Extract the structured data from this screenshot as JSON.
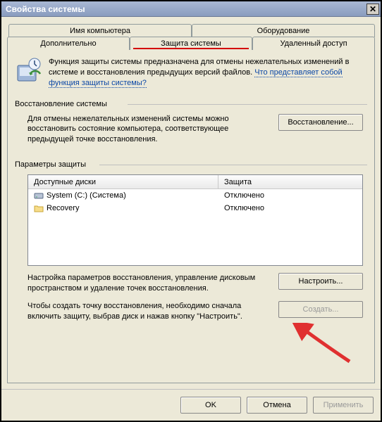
{
  "window": {
    "title": "Свойства системы"
  },
  "tabs_top": [
    {
      "label": "Имя компьютера"
    },
    {
      "label": "Оборудование"
    }
  ],
  "tabs_bottom": [
    {
      "label": "Дополнительно"
    },
    {
      "label": "Защита системы"
    },
    {
      "label": "Удаленный доступ"
    }
  ],
  "intro": {
    "text": "Функция защиты системы предназначена для отмены нежелательных изменений в системе и восстановления предыдущих версий файлов. ",
    "link1": "Что представляет собой",
    "link2": "функция защиты системы?"
  },
  "restore_section": {
    "heading": "Восстановление системы",
    "text": "Для отмены нежелательных изменений системы можно восстановить состояние компьютера, соответствующее предыдущей точке восстановления.",
    "button": "Восстановление..."
  },
  "params_section": {
    "heading": "Параметры защиты",
    "columns": {
      "disks": "Доступные диски",
      "protection": "Защита"
    },
    "rows": [
      {
        "icon": "hdd",
        "name": "System (C:) (Система)",
        "protection": "Отключено"
      },
      {
        "icon": "folder",
        "name": "Recovery",
        "protection": "Отключено"
      }
    ],
    "configure_text": "Настройка параметров восстановления, управление дисковым пространством и удаление точек восстановления.",
    "configure_button": "Настроить...",
    "create_text": "Чтобы создать точку восстановления, необходимо сначала включить защиту, выбрав диск и нажав кнопку \"Настроить\".",
    "create_button": "Создать..."
  },
  "buttons": {
    "ok": "OK",
    "cancel": "Отмена",
    "apply": "Применить"
  }
}
